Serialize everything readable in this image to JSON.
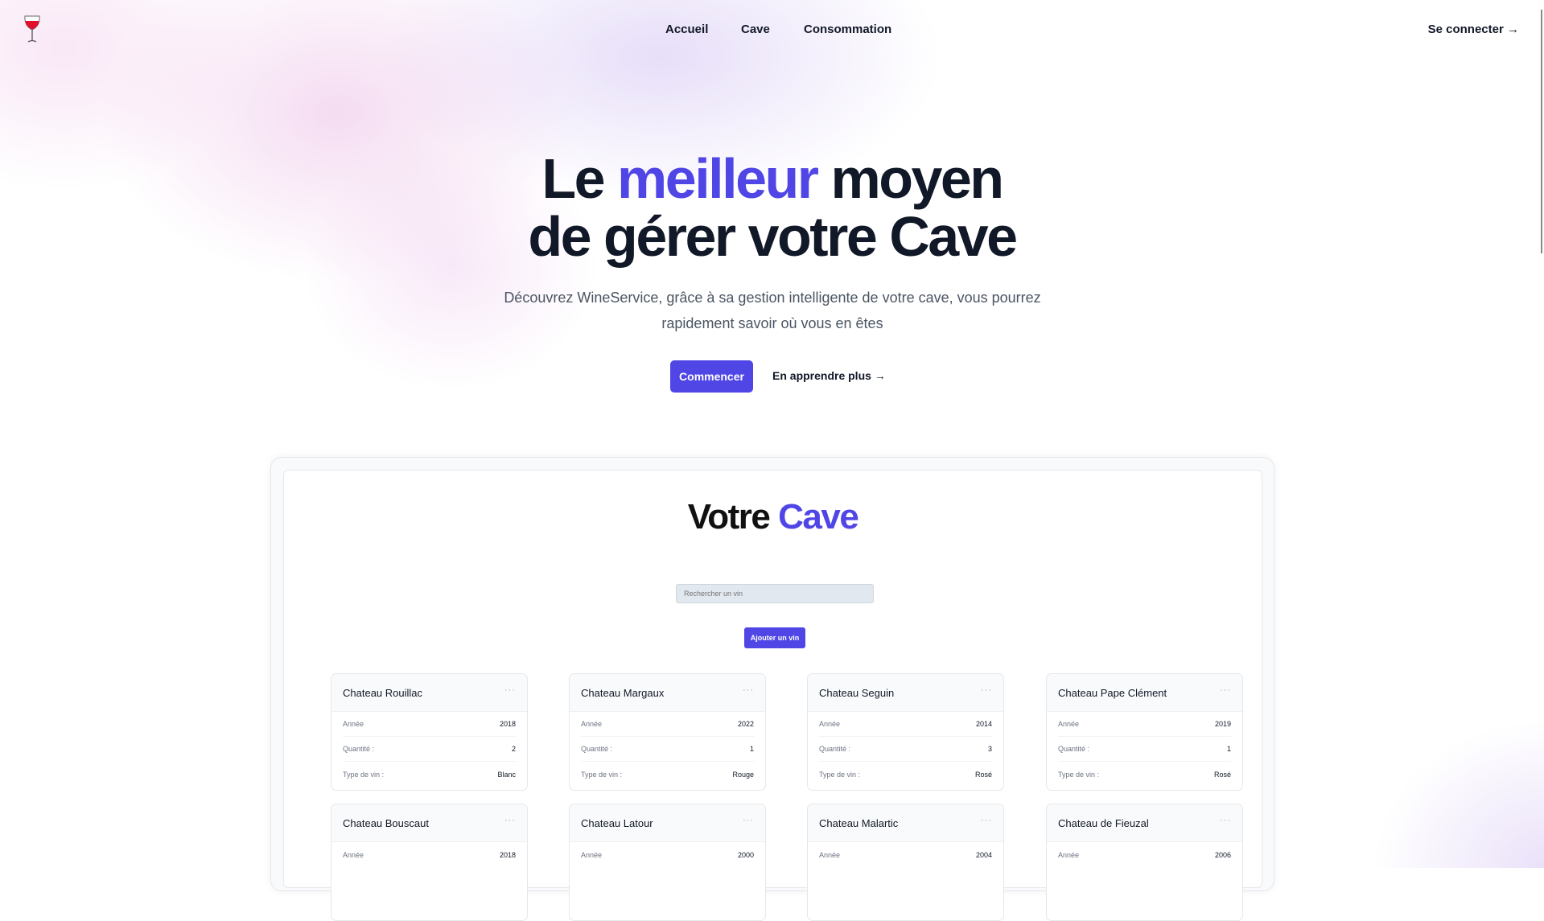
{
  "nav": {
    "links": [
      "Accueil",
      "Cave",
      "Consommation"
    ],
    "login": "Se connecter →"
  },
  "hero": {
    "title_pre": "Le ",
    "title_accent": "meilleur",
    "title_post": " moyen",
    "title_line2": "de gérer votre Cave",
    "subtitle": "Découvrez WineService, grâce à sa gestion intelligente de votre cave, vous pourrez rapidement savoir où vous en êtes",
    "cta_primary": "Commencer",
    "cta_secondary": "En apprendre plus →"
  },
  "cave": {
    "title_pre": "Votre ",
    "title_accent": "Cave",
    "search_placeholder": "Rechercher un vin",
    "add_label": "Ajouter un vin",
    "labels": {
      "year": "Année",
      "qty": "Quantité :",
      "type": "Type de vin :"
    },
    "wines": [
      {
        "name": "Chateau Rouillac",
        "year": "2018",
        "qty": "2",
        "type": "Blanc"
      },
      {
        "name": "Chateau Margaux",
        "year": "2022",
        "qty": "1",
        "type": "Rouge"
      },
      {
        "name": "Chateau Seguin",
        "year": "2014",
        "qty": "3",
        "type": "Rosé"
      },
      {
        "name": "Chateau Pape Clément",
        "year": "2019",
        "qty": "1",
        "type": "Rosé"
      },
      {
        "name": "Chateau Bouscaut",
        "year": "2018"
      },
      {
        "name": "Chateau Latour",
        "year": "2000"
      },
      {
        "name": "Chateau Malartic",
        "year": "2004"
      },
      {
        "name": "Chateau de Fieuzal",
        "year": "2006"
      }
    ]
  },
  "colors": {
    "accent": "#4f46e5",
    "text": "#111827"
  }
}
